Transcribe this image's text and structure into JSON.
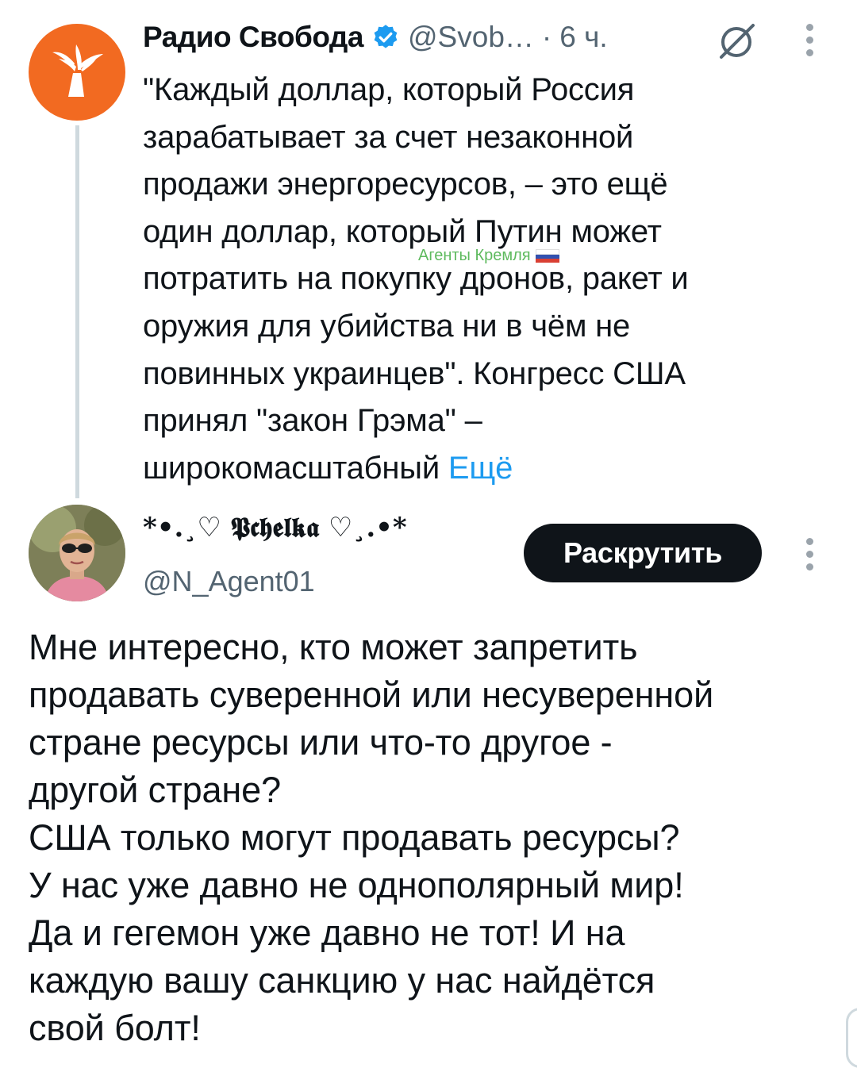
{
  "original_tweet": {
    "author_name": "Радио Свобода",
    "verified_icon": "verified-badge-icon",
    "handle": "@Svob…",
    "separator": "·",
    "time": "6 ч.",
    "text_lines": [
      "\"Каждый доллар, который Россия",
      "зарабатывает за счет незаконной",
      "продажи энергоресурсов, – это ещё",
      "один доллар, который Путин может",
      "потратить на покупку дронов, ракет и",
      "оружия для убийства ни в чём не",
      "повинных украинцев\". Конгресс США",
      "принял \"закон Грэма\" –",
      "широкомасштабный"
    ],
    "more_label": "Ещё",
    "watermark": "Агенты Кремля",
    "accent_color": "#f26a21"
  },
  "reply": {
    "author_name": "*•.¸♡ 𝕻𝖈𝖍𝖊𝖑𝖐𝖆 ♡¸.•*",
    "handle": "@N_Agent01",
    "promote_label": "Раскрутить",
    "text_lines": [
      "Мне интересно, кто может запретить",
      "продавать суверенной или несуверенной",
      "стране ресурсы или что-то другое -",
      "другой стране?",
      "США только могут продавать ресурсы?",
      "У нас уже давно не однополярный мир!",
      "Да и гегемон уже давно не тот! И на",
      "каждую вашу санкцию у нас найдётся",
      "свой болт!"
    ]
  },
  "colors": {
    "link": "#1d9bf0",
    "text": "#0f1419",
    "muted": "#536471"
  }
}
